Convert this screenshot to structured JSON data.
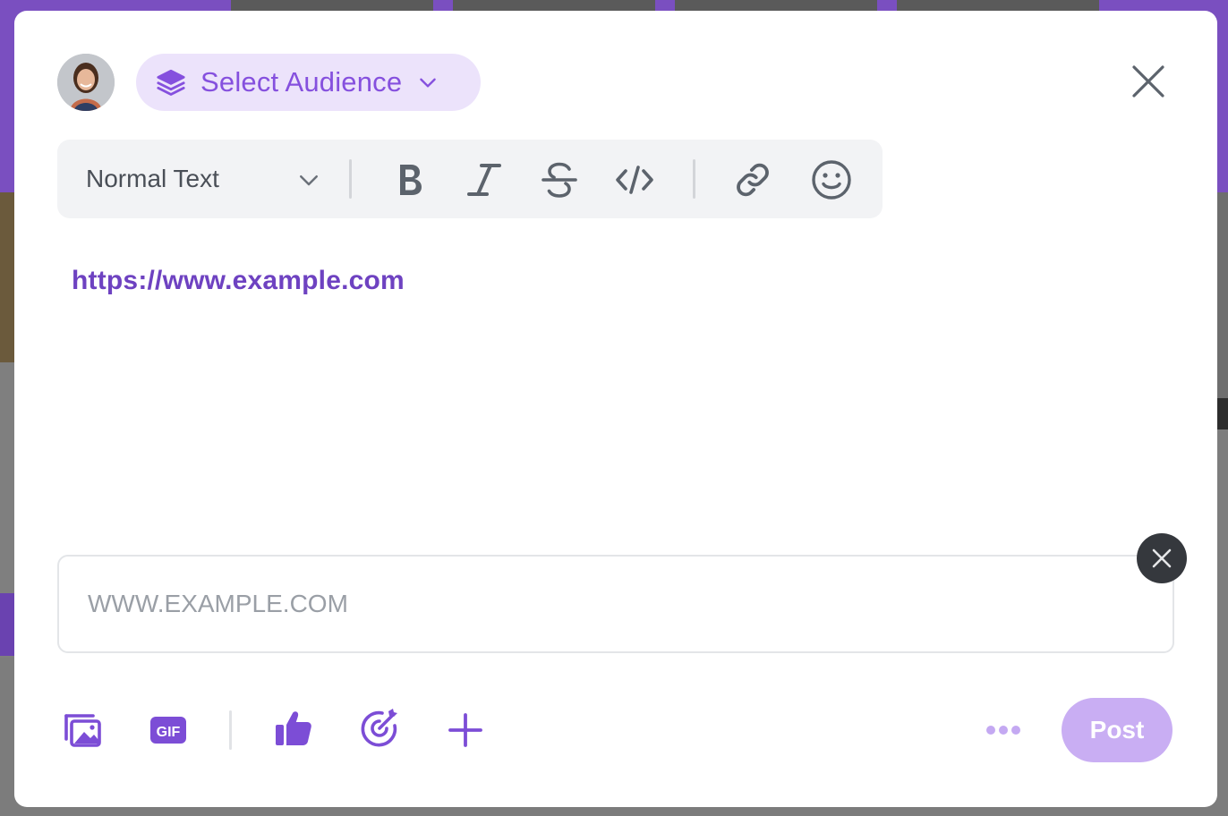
{
  "composer": {
    "audience_label": "Select Audience",
    "text_style_label": "Normal Text",
    "content_link": "https://www.example.com",
    "link_input_placeholder": "WWW.EXAMPLE.COM",
    "post_label": "Post"
  },
  "icons": {
    "audience": "layers-icon",
    "close": "close-icon",
    "bold": "bold-icon",
    "italic": "italic-icon",
    "strikethrough": "strikethrough-icon",
    "code": "code-icon",
    "link": "link-icon",
    "emoji": "smile-icon",
    "media": "image-gallery-icon",
    "gif": "gif-icon",
    "kudos": "thumbs-up-icon",
    "goal": "target-icon",
    "add": "plus-icon",
    "more": "more-dots-icon"
  },
  "colors": {
    "accent": "#8550de",
    "accent_light": "#ece3fb",
    "link": "#6e42c1",
    "post_disabled": "#c9aef3"
  }
}
